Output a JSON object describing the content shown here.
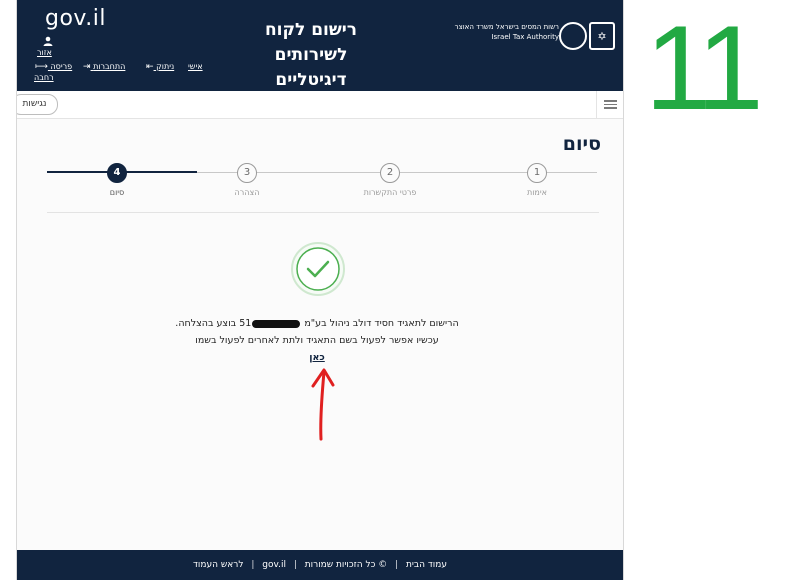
{
  "header": {
    "gov_logo": "gov.il",
    "title_line1": "רישום לקוח לשירותים",
    "title_line2": "דיגיטליים",
    "tax_authority_he": "רשות המסים בישראל משרד האוצר",
    "tax_authority_en": "Israel Tax Authority",
    "user_link": "אזור",
    "personal_link": "אישי",
    "disconnect_link": "ניתוק",
    "connect_link": "התחברות",
    "wide_view_line1": "פריסה",
    "wide_view_line2": "רחבה"
  },
  "toolbar": {
    "accessibility_label": "נגישות"
  },
  "content": {
    "heading": "סיום",
    "steps": [
      {
        "number": "1",
        "label": "אימות"
      },
      {
        "number": "2",
        "label": "פרטי התקשרות"
      },
      {
        "number": "3",
        "label": "הצהרה"
      },
      {
        "number": "4",
        "label": "סיום"
      }
    ],
    "success_line1_part1": "הרישום לתאגיד חסיד דולב ניהול בע\"מ",
    "success_line1_part2": "51",
    "success_line1_part3": "בוצע בהצלחה.",
    "success_line2": "עכשיו אפשר לפעול בשם התאגיד ולתת לאחרים לפעול בשמו",
    "here_link": "כאן"
  },
  "footer": {
    "home": "עמוד הבית",
    "copyright": "© כל הזכויות שמורות",
    "gov": "gov.il",
    "top": "לראש העמוד"
  },
  "overlay": {
    "number": "11"
  },
  "colors": {
    "brand_navy": "#11243f",
    "success_green": "#4caf50",
    "annotation_red": "#e02020",
    "overlay_green": "#22a943"
  }
}
